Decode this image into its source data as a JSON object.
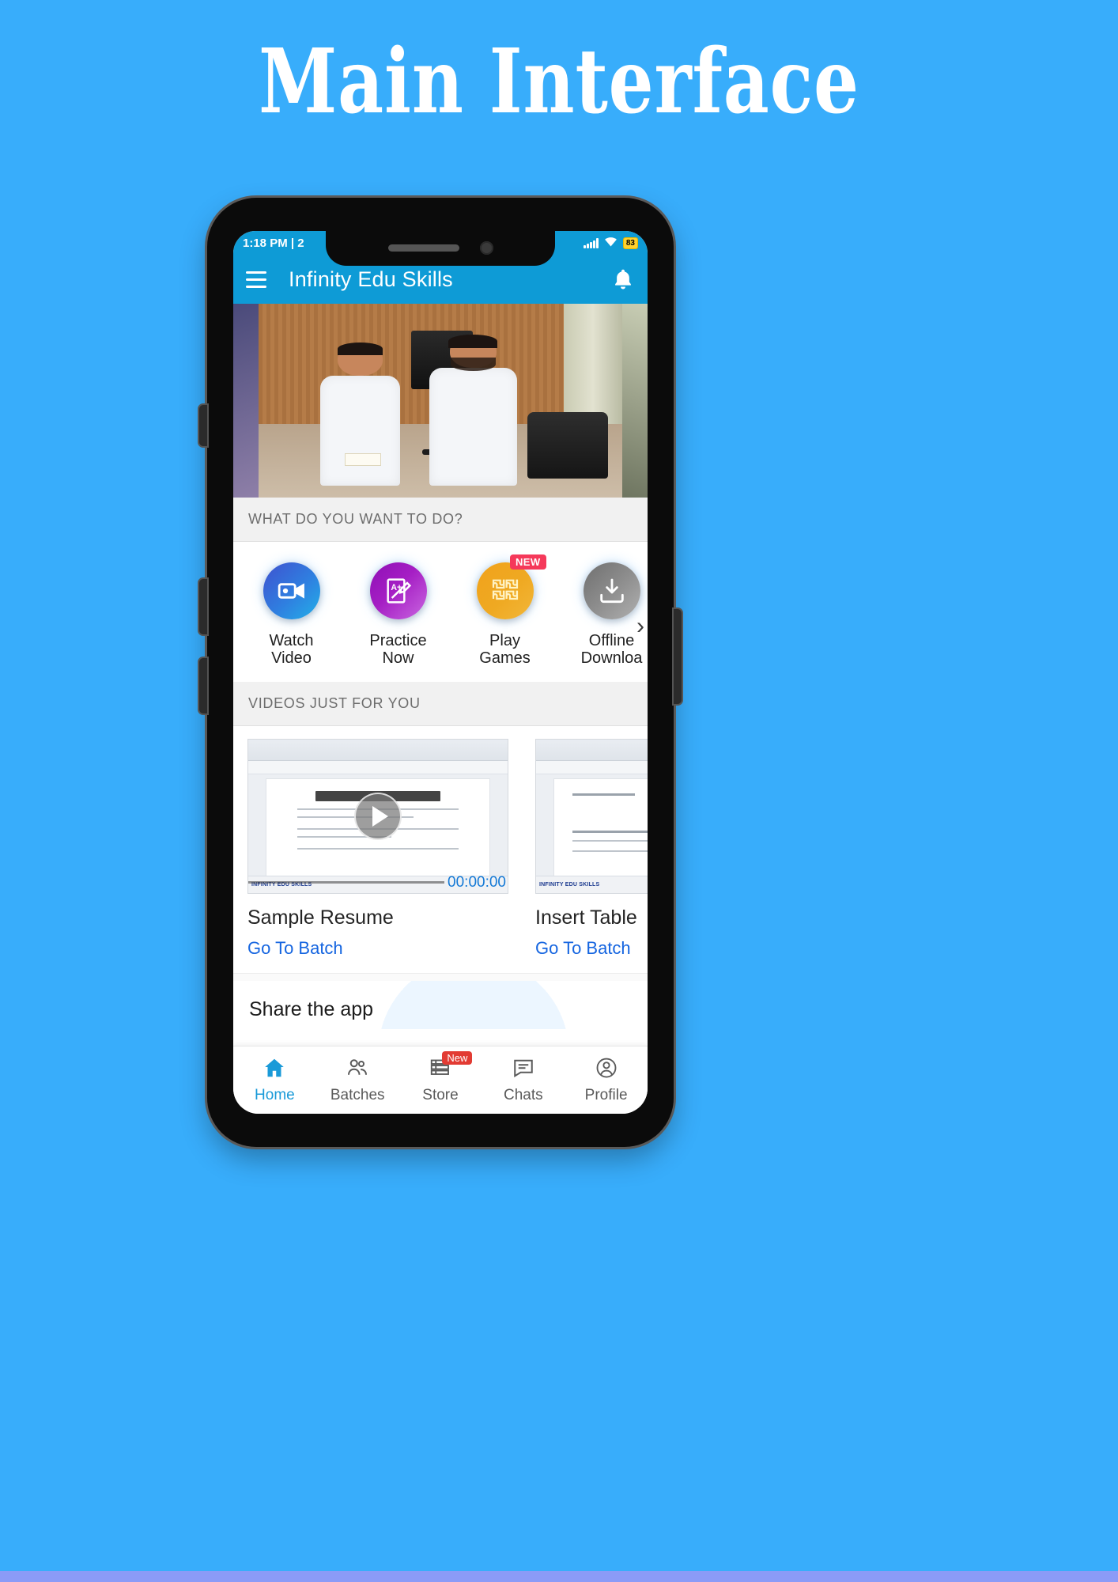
{
  "poster": {
    "title": "Main Interface",
    "background_color": "#38ADFB",
    "bottom_strip_color": "#8B9BF7"
  },
  "status_bar": {
    "time": "1:18 PM | 2",
    "signal_icon": "signal-bars-icon",
    "wifi_icon": "wifi-icon",
    "battery_label": "83"
  },
  "app_bar": {
    "menu_icon": "hamburger-menu-icon",
    "title": "Infinity Edu Skills",
    "notification_icon": "bell-icon",
    "color": "#0E9BD6"
  },
  "carousel": {
    "name": "banner-carousel",
    "slide_label": "photo-award-ceremony"
  },
  "quick_actions": {
    "section_title": "WHAT DO YOU WANT TO DO?",
    "next_arrow": "›",
    "items": [
      {
        "label": "Watch\nVideo",
        "icon": "video-camera-icon",
        "badge": ""
      },
      {
        "label": "Practice\nNow",
        "icon": "a-plus-paper-pencil-icon",
        "badge": ""
      },
      {
        "label": "Play\nGames",
        "icon": "puzzle-pieces-icon",
        "badge": "NEW"
      },
      {
        "label": "Offline\nDownloa",
        "icon": "download-tray-icon",
        "badge": ""
      }
    ]
  },
  "videos": {
    "section_title": "VIDEOS JUST FOR YOU",
    "items": [
      {
        "title": "Sample Resume",
        "link": "Go To Batch",
        "timecode": "00:00:00",
        "thumb_heading": "First Last Name",
        "thumb_logo": "INFINITY EDU SKILLS",
        "play_icon": "play-circle-icon"
      },
      {
        "title": "Insert Table",
        "link": "Go To Batch",
        "timecode": "",
        "thumb_heading": "Company logo",
        "thumb_logo": "INFINITY EDU SKILLS",
        "play_icon": "play-circle-icon"
      }
    ]
  },
  "share": {
    "title": "Share the app"
  },
  "bottom_nav": {
    "items": [
      {
        "label": "Home",
        "icon": "home-icon",
        "active": true,
        "badge": ""
      },
      {
        "label": "Batches",
        "icon": "people-icon",
        "active": false,
        "badge": ""
      },
      {
        "label": "Store",
        "icon": "books-icon",
        "active": false,
        "badge": "New"
      },
      {
        "label": "Chats",
        "icon": "chat-bubble-icon",
        "active": false,
        "badge": ""
      },
      {
        "label": "Profile",
        "icon": "person-circle-icon",
        "active": false,
        "badge": ""
      }
    ],
    "active_color": "#1A9AD8",
    "badge_color": "#E23B33"
  }
}
